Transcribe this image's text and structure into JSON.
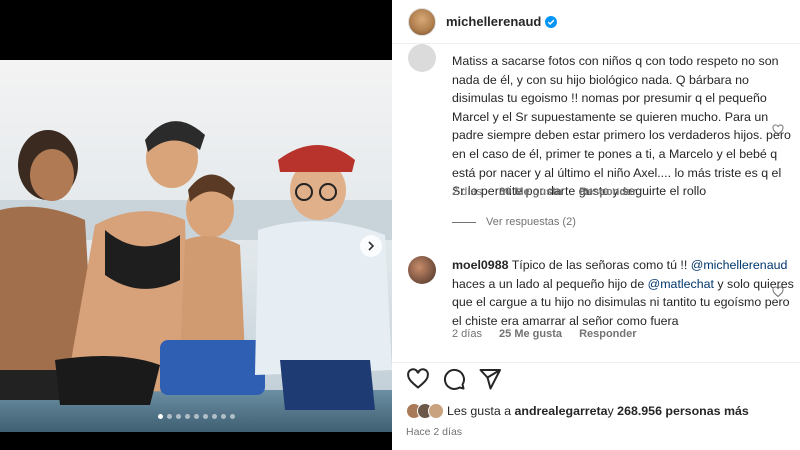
{
  "post": {
    "username": "michellerenaud",
    "media_dots": 9,
    "media_active_dot": 1
  },
  "comments": [
    {
      "partial_header": true,
      "text": "Matiss a sacarse fotos con niños q con todo respeto no son nada de él, y con su hijo biológico nada. Q bárbara no disimulas tu egoismo !! nomas por presumir q el pequeño Marcel y el Sr supuestamente se quieren mucho. Para un padre siempre deben estar primero los verdaderos hijos. pero en el caso de él, primer te pones a ti, a Marcelo y el bebé q está por nacer y al último el niño Axel.... lo más triste es q el Sr lo permite por darte gusto y seguirte el rollo",
      "time": "2 días",
      "likes": "30 Me gusta",
      "reply": "Responder",
      "view_replies": "Ver respuestas (2)"
    },
    {
      "user": "moel0988",
      "text_1": "Típico de las señoras como tú !! ",
      "mention_1": "@michellerenaud",
      "text_2": " haces a un lado al pequeño hijo de ",
      "mention_2": "@matlechat",
      "text_3": " y solo quieres que el cargue a tu hijo no disimulas ni tantito tu egoísmo pero el chiste era amarrar al señor como fuera",
      "time": "2 días",
      "likes": "25 Me gusta",
      "reply": "Responder"
    }
  ],
  "likes_summary": {
    "prefix": "Les gusta a ",
    "user": "andrealegarreta",
    "middle": " y ",
    "count": "268.956 personas más"
  },
  "timestamp": "Hace 2 días",
  "colors": {
    "verified": "#0095f6",
    "mention": "#00376b",
    "muted": "#737373"
  }
}
